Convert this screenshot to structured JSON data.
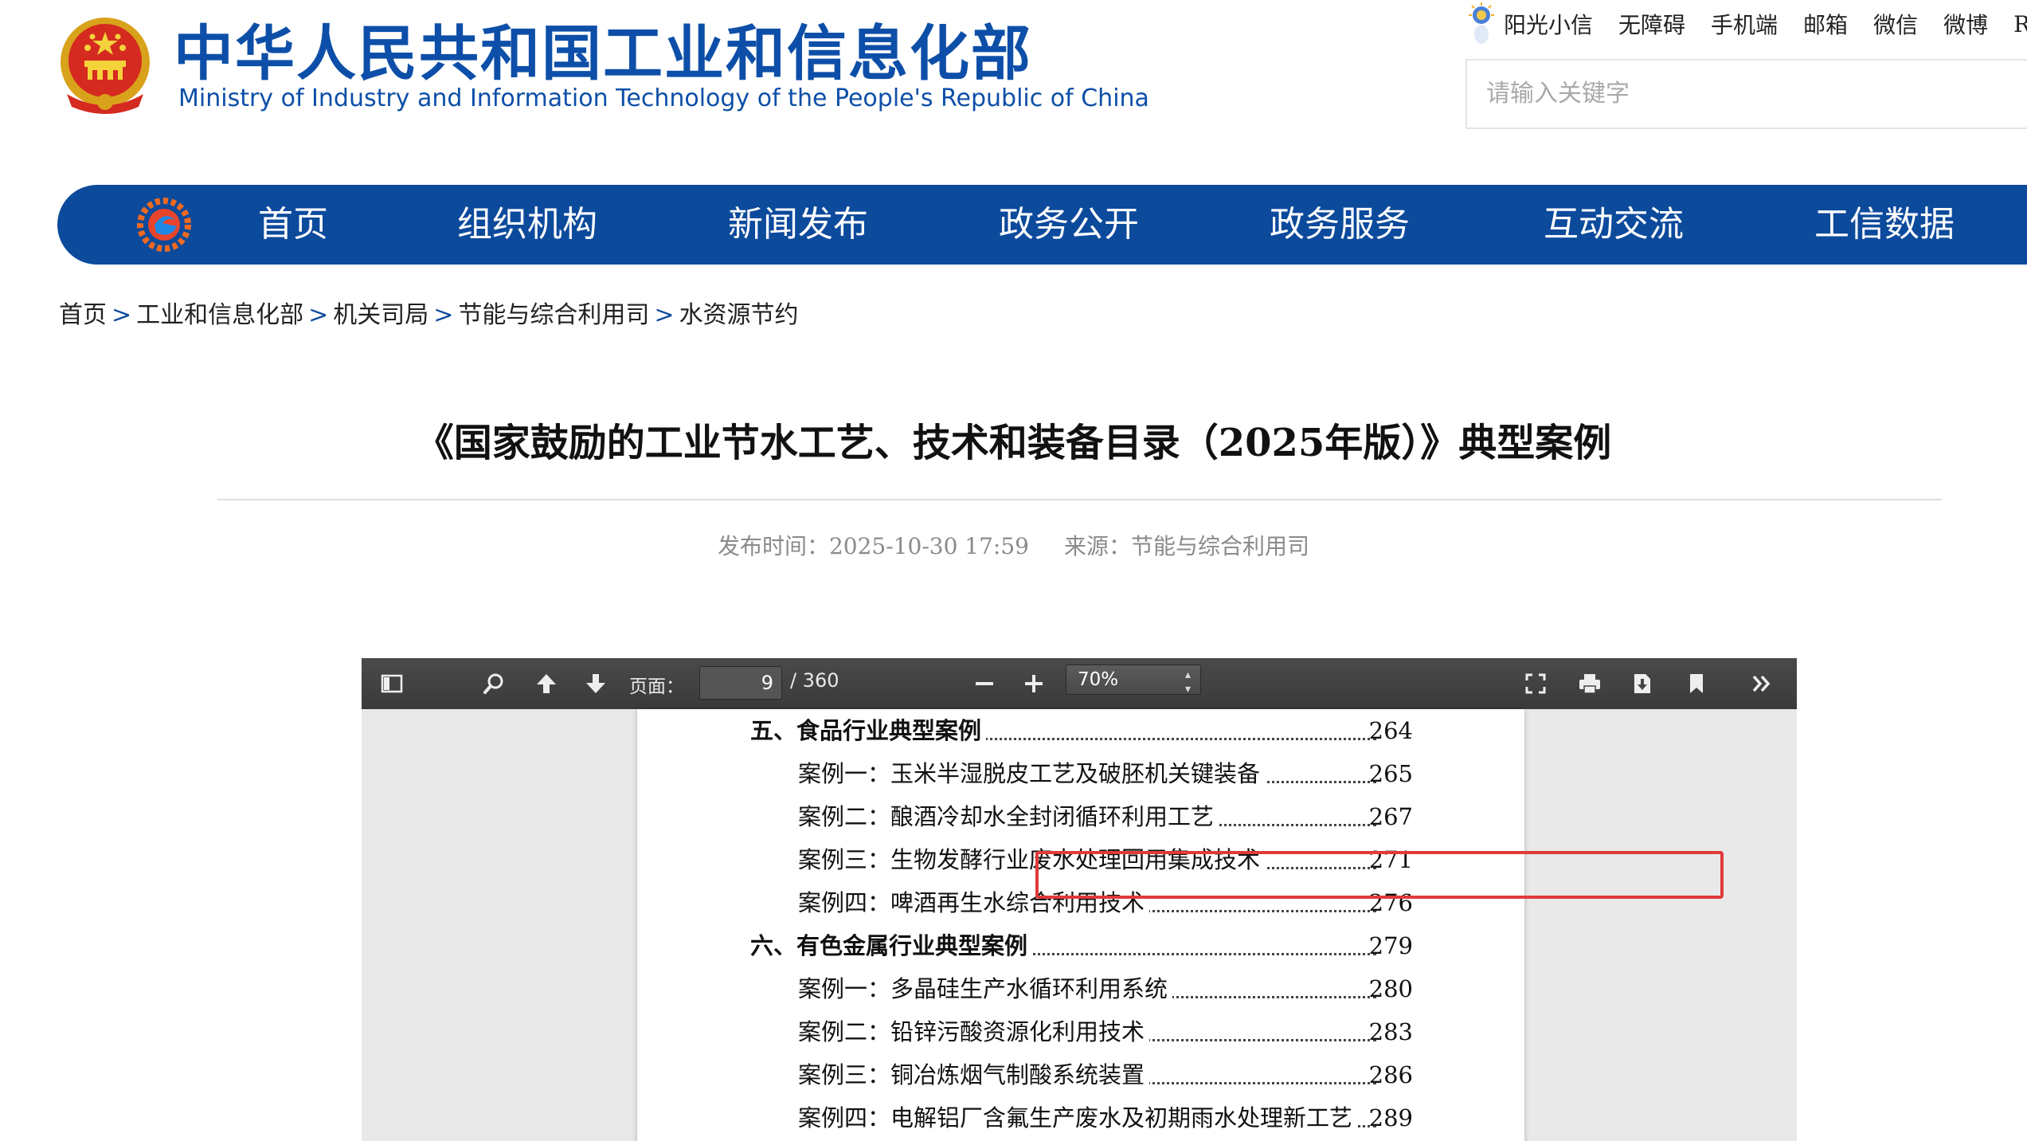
{
  "header": {
    "title_cn": "中华人民共和国工业和信息化部",
    "title_en": "Ministry of Industry and Information Technology of the People's Republic of China",
    "emblem_icon": "national-emblem-icon"
  },
  "top_links": [
    "阳光小信",
    "无障碍",
    "手机端",
    "邮箱",
    "微信",
    "微博",
    "RS"
  ],
  "search": {
    "placeholder": "请输入关键字"
  },
  "nav": {
    "items": [
      "首页",
      "组织机构",
      "新闻发布",
      "政务公开",
      "政务服务",
      "互动交流",
      "工信数据"
    ]
  },
  "breadcrumb": [
    "首页",
    "工业和信息化部",
    "机关司局",
    "节能与综合利用司",
    "水资源节约"
  ],
  "article": {
    "title": "《国家鼓励的工业节水工艺、技术和装备目录（2025年版）》典型案例",
    "publish_time": "发布时间：2025-10-30 17:59",
    "source": "来源：节能与综合利用司"
  },
  "viewer": {
    "page_label": "页面：",
    "current_page": "9",
    "total_pages": "/ 360",
    "zoom": "70%"
  },
  "toc": [
    {
      "text": "五、食品行业典型案例",
      "page": "264",
      "level": 1
    },
    {
      "text": "案例一：玉米半湿脱皮工艺及破胚机关键装备",
      "page": "265",
      "level": 2
    },
    {
      "text": "案例二：酿酒冷却水全封闭循环利用工艺",
      "page": "267",
      "level": 2,
      "highlighted": true
    },
    {
      "text": "案例三：生物发酵行业废水处理回用集成技术",
      "page": "271",
      "level": 2
    },
    {
      "text": "案例四：啤酒再生水综合利用技术",
      "page": "276",
      "level": 2
    },
    {
      "text": "六、有色金属行业典型案例",
      "page": "279",
      "level": 1
    },
    {
      "text": "案例一：多晶硅生产水循环利用系统",
      "page": "280",
      "level": 2
    },
    {
      "text": "案例二：铅锌污酸资源化利用技术",
      "page": "283",
      "level": 2
    },
    {
      "text": "案例三：铜冶炼烟气制酸系统装置",
      "page": "286",
      "level": 2
    },
    {
      "text": "案例四：电解铝厂含氟生产废水及初期雨水处理新工艺",
      "page": "289",
      "level": 2
    }
  ],
  "colors": {
    "brand_blue": "#0c4a9c",
    "title_blue": "#0d4fa8",
    "highlight_red": "#e03a3a"
  }
}
